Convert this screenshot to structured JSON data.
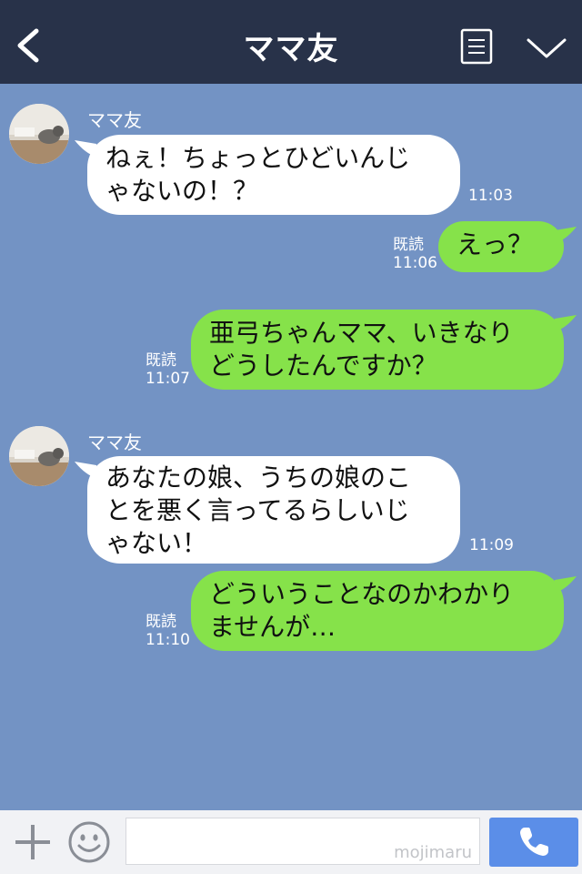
{
  "header": {
    "title": "ママ友"
  },
  "colors": {
    "header_bg": "#283249",
    "chat_bg": "#7393c4",
    "incoming": "#ffffff",
    "outgoing": "#86e24a",
    "call_button": "#5b8ee8"
  },
  "icons": {
    "back": "chevron-left-icon",
    "menu": "list-icon",
    "more": "chevron-down-icon",
    "add": "plus-icon",
    "emoji": "smiley-icon",
    "call": "phone-icon"
  },
  "messages": [
    {
      "sender": "ママ友",
      "direction": "in",
      "lines": [
        "ねぇ！ちょっとひどいんじ",
        "ゃないの！？"
      ],
      "time": "11:03"
    },
    {
      "direction": "out",
      "lines": [
        "えっ？"
      ],
      "read": "既読",
      "time": "11:06"
    },
    {
      "direction": "out",
      "lines": [
        "亜弓ちゃんママ、いきなり",
        "どうしたんですか？"
      ],
      "read": "既読",
      "time": "11:07"
    },
    {
      "sender": "ママ友",
      "direction": "in",
      "lines": [
        "あなたの娘、うちの娘のこ",
        "とを悪く言ってるらしいじ",
        "ゃない！"
      ],
      "time": "11:09"
    },
    {
      "direction": "out",
      "lines": [
        "どういうことなのかわかり",
        "ませんが…"
      ],
      "read": "既読",
      "time": "11:10"
    }
  ],
  "footer": {
    "watermark": "mojimaru"
  }
}
